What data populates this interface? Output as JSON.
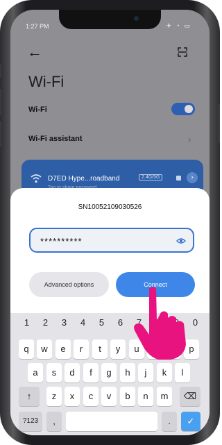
{
  "status": {
    "time": "1:27 PM",
    "icons": "✈ ◔ ▭"
  },
  "header": {
    "back_icon": "←",
    "page_title": "Wi-Fi"
  },
  "rows": {
    "wifi_label": "Wi-Fi",
    "wifi_enabled": true,
    "assistant_label": "Wi-Fi assistant",
    "assistant_chevron": "›"
  },
  "network": {
    "name": "D7ED Hype...roadband",
    "band": "2.4G/5G",
    "subtitle": "Tap to share password",
    "arrow": "›"
  },
  "dialog": {
    "ssid": "SN10052109030526",
    "password_masked": "**********",
    "advanced_label": "Advanced options",
    "connect_label": "Connect"
  },
  "keyboard": {
    "numbers": [
      "1",
      "2",
      "3",
      "4",
      "5",
      "6",
      "7",
      "8",
      "9",
      "0"
    ],
    "row1": [
      "q",
      "w",
      "e",
      "r",
      "t",
      "y",
      "u",
      "i",
      "o",
      "p"
    ],
    "row2": [
      "a",
      "s",
      "d",
      "f",
      "g",
      "h",
      "j",
      "k",
      "l"
    ],
    "row3": [
      "z",
      "x",
      "c",
      "v",
      "b",
      "n",
      "m"
    ],
    "shift": "↑",
    "backspace": "⌫",
    "symbols": "?123",
    "comma": ",",
    "period": ".",
    "done": "✓"
  },
  "colors": {
    "accent": "#3e86e8",
    "network_card": "#2d5ea6",
    "pointer_hand": "#e8137f"
  }
}
